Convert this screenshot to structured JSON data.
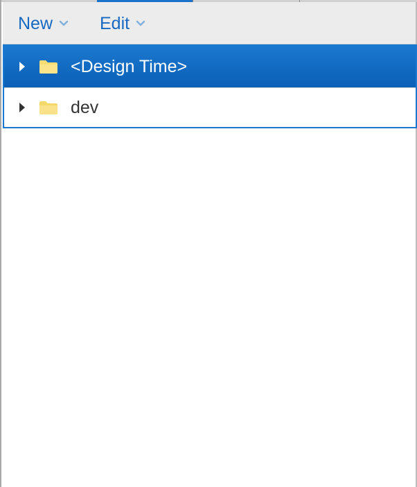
{
  "toolbar": {
    "new_label": "New",
    "edit_label": "Edit"
  },
  "tree": {
    "items": [
      {
        "label": "<Design Time>",
        "selected": true,
        "icon": "folder-icon"
      },
      {
        "label": "dev",
        "selected": false,
        "icon": "folder-icon"
      }
    ]
  },
  "colors": {
    "accent": "#1a73c9",
    "selection": "#0b5fb6",
    "toolbar_bg": "#ececec",
    "folder": "#f7dd74"
  }
}
